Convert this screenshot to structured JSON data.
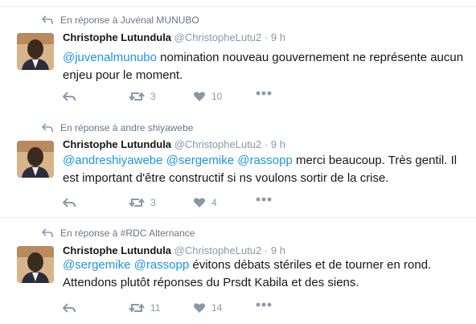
{
  "tweets": [
    {
      "context": "En réponse à Juvénal MUNUBO",
      "name": "Christophe Lutundula",
      "handle": "@ChristopheLutu2",
      "dot": "·",
      "time": "9 h",
      "mentions": "@juvenalmunubo",
      "text": " nomination nouveau gouvernement ne représente aucun enjeu pour le moment.",
      "retweets": "3",
      "likes": "10"
    },
    {
      "context": "En réponse à andre shiyawebe",
      "name": "Christophe Lutundula",
      "handle": "@ChristopheLutu2",
      "dot": "·",
      "time": "9 h",
      "mentions": "@andreshiyawebe @sergemike @rassopp",
      "text": " merci beaucoup. Très gentil. Il est important d'être constructif si ns voulons sortir de la crise.",
      "retweets": "3",
      "likes": "4"
    },
    {
      "context": "En réponse à #RDC Alternance",
      "name": "Christophe Lutundula",
      "handle": "@ChristopheLutu2",
      "dot": "·",
      "time": "9 h",
      "mentions": "@sergemike @rassopp",
      "text": " évitons débats stériles et de tourner en rond. Attendons plutôt réponses du Prsdt Kabila et des siens.",
      "retweets": "11",
      "likes": "14"
    }
  ],
  "colors": {
    "link": "#1b95e0",
    "secondary": "#657786",
    "icon": "#8899a6",
    "border": "#e6ecf0"
  }
}
